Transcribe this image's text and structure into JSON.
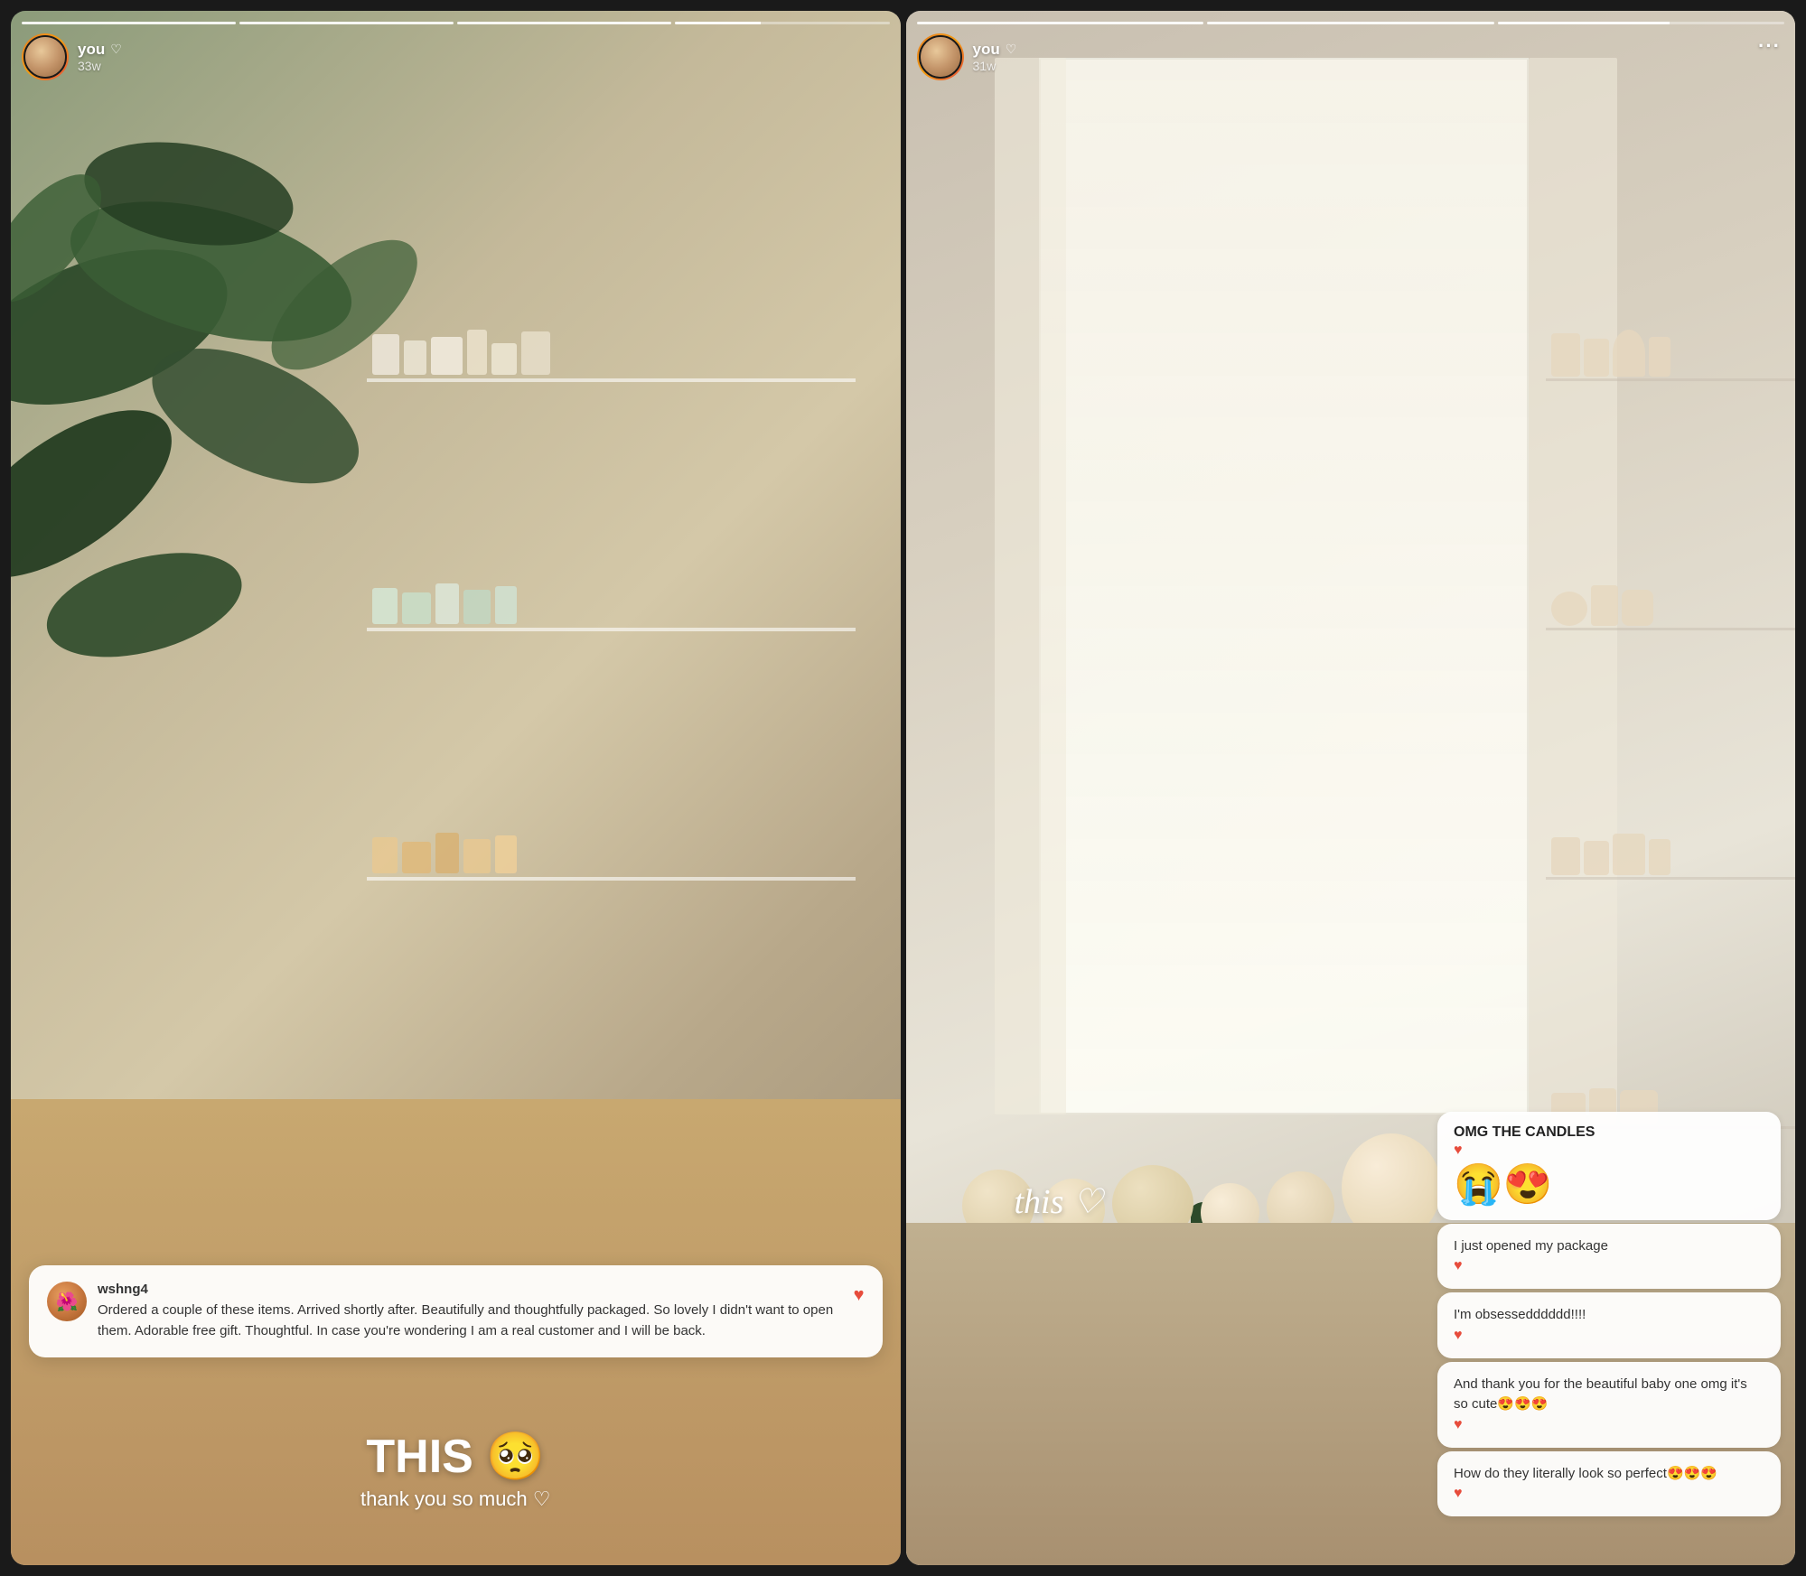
{
  "stories": [
    {
      "id": "story-1",
      "username": "you",
      "heart": "♡",
      "timestamp": "33w",
      "progress_bars": [
        {
          "filled": true
        },
        {
          "filled": true
        },
        {
          "filled": true
        },
        {
          "filled": false,
          "current": true
        }
      ],
      "comment": {
        "username": "wshng4",
        "text": "Ordered a couple of these items. Arrived shortly after.  Beautifully and thoughtfully packaged.  So lovely I didn't want to open them. Adorable free gift.  Thoughtful.  In case you're wondering I am a real customer and I will be back.",
        "has_heart": true
      },
      "bottom_caption": "THIS 🥺",
      "sub_caption": "thank you so much ♡"
    },
    {
      "id": "story-2",
      "username": "you",
      "heart": "♡",
      "timestamp": "31w",
      "has_more": true,
      "progress_bars": [
        {
          "filled": true
        },
        {
          "filled": true
        },
        {
          "filled": false,
          "current": true
        }
      ],
      "this_italic": "this ♡",
      "chat_messages": [
        {
          "type": "title",
          "text": "OMG THE CANDLES"
        },
        {
          "type": "heart",
          "text": "♥"
        },
        {
          "type": "emoji",
          "text": "😭😍"
        },
        {
          "type": "message",
          "text": "I just opened my package"
        },
        {
          "type": "heart",
          "text": "♥"
        },
        {
          "type": "message",
          "text": "I'm obsessedddddd!!!!"
        },
        {
          "type": "heart",
          "text": "♥"
        },
        {
          "type": "message",
          "text": "And thank you for the beautiful baby one omg it's so cute😍😍😍"
        },
        {
          "type": "heart",
          "text": "♥"
        },
        {
          "type": "message",
          "text": "How do they literally look so perfect😍😍😍"
        },
        {
          "type": "heart",
          "text": "♥"
        }
      ]
    }
  ],
  "icons": {
    "heart_white": "♡",
    "heart_red": "♥",
    "more": "···"
  }
}
